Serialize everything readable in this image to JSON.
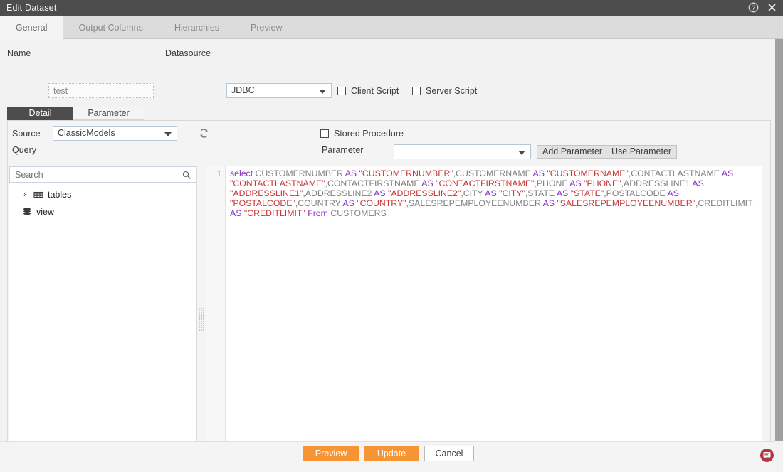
{
  "window": {
    "title": "Edit Dataset",
    "help_icon": "help-icon",
    "close_icon": "close-icon"
  },
  "top_tabs": [
    {
      "label": "General",
      "active": true
    },
    {
      "label": "Output Columns",
      "active": false
    },
    {
      "label": "Hierarchies",
      "active": false
    },
    {
      "label": "Preview",
      "active": false
    }
  ],
  "form": {
    "name_label": "Name",
    "name_value": "test",
    "name_placeholder": "",
    "datasource_label": "Datasource",
    "datasource_value": "JDBC",
    "client_script_label": "Client Script",
    "client_script_checked": false,
    "server_script_label": "Server Script",
    "server_script_checked": false
  },
  "sub_tabs": [
    {
      "label": "Detail",
      "active": true
    },
    {
      "label": "Parameter",
      "active": false
    }
  ],
  "panel": {
    "source_label": "Source",
    "source_value": "ClassicModels",
    "refresh_icon": "refresh-icon",
    "stored_procedure_label": "Stored Procedure",
    "stored_procedure_checked": false,
    "query_label": "Query",
    "parameter_label": "Parameter",
    "parameter_value": "",
    "add_parameter_label": "Add Parameter",
    "use_parameter_label": "Use Parameter"
  },
  "tree": {
    "search_placeholder": "Search",
    "search_value": "",
    "search_icon": "search-icon",
    "items": [
      {
        "label": "tables",
        "icon": "table-grid-icon",
        "expandable": true,
        "chevron": "›"
      },
      {
        "label": "view",
        "icon": "database-stack-icon",
        "expandable": false,
        "chevron": ""
      }
    ]
  },
  "editor": {
    "line_number": "1",
    "tokens": [
      {
        "t": "select",
        "k": "kw"
      },
      {
        "t": " CUSTOMERNUMBER ",
        "k": "plain"
      },
      {
        "t": "AS",
        "k": "kw"
      },
      {
        "t": " ",
        "k": "plain"
      },
      {
        "t": "\"CUSTOMERNUMBER\"",
        "k": "str"
      },
      {
        "t": ",CUSTOMERNAME ",
        "k": "plain"
      },
      {
        "t": "AS",
        "k": "kw"
      },
      {
        "t": " ",
        "k": "plain"
      },
      {
        "t": "\"CUSTOMERNAME\"",
        "k": "str"
      },
      {
        "t": ",CONTACTLASTNAME ",
        "k": "plain"
      },
      {
        "t": "AS",
        "k": "kw"
      },
      {
        "t": " ",
        "k": "plain"
      },
      {
        "t": "\"CONTACTLASTNAME\"",
        "k": "str"
      },
      {
        "t": ",CONTACTFIRSTNAME ",
        "k": "plain"
      },
      {
        "t": "AS",
        "k": "kw"
      },
      {
        "t": " ",
        "k": "plain"
      },
      {
        "t": "\"CONTACTFIRSTNAME\"",
        "k": "str"
      },
      {
        "t": ",PHONE ",
        "k": "plain"
      },
      {
        "t": "AS",
        "k": "kw"
      },
      {
        "t": " ",
        "k": "plain"
      },
      {
        "t": "\"PHONE\"",
        "k": "str"
      },
      {
        "t": ",ADDRESSLINE1 ",
        "k": "plain"
      },
      {
        "t": "AS",
        "k": "kw"
      },
      {
        "t": " ",
        "k": "plain"
      },
      {
        "t": "\"ADDRESSLINE1\"",
        "k": "str"
      },
      {
        "t": ",ADDRESSLINE2 ",
        "k": "plain"
      },
      {
        "t": "AS",
        "k": "kw"
      },
      {
        "t": " ",
        "k": "plain"
      },
      {
        "t": "\"ADDRESSLINE2\"",
        "k": "str"
      },
      {
        "t": ",CITY ",
        "k": "plain"
      },
      {
        "t": "AS",
        "k": "kw"
      },
      {
        "t": " ",
        "k": "plain"
      },
      {
        "t": "\"CITY\"",
        "k": "str"
      },
      {
        "t": ",STATE ",
        "k": "plain"
      },
      {
        "t": "AS",
        "k": "kw"
      },
      {
        "t": " ",
        "k": "plain"
      },
      {
        "t": "\"STATE\"",
        "k": "str"
      },
      {
        "t": ",POSTALCODE ",
        "k": "plain"
      },
      {
        "t": "AS",
        "k": "kw"
      },
      {
        "t": " ",
        "k": "plain"
      },
      {
        "t": "\"POSTALCODE\"",
        "k": "str"
      },
      {
        "t": ",COUNTRY ",
        "k": "plain"
      },
      {
        "t": "AS",
        "k": "kw"
      },
      {
        "t": " ",
        "k": "plain"
      },
      {
        "t": "\"COUNTRY\"",
        "k": "str"
      },
      {
        "t": ",SALESREPEMPLOYEENUMBER ",
        "k": "plain"
      },
      {
        "t": "AS",
        "k": "kw"
      },
      {
        "t": " ",
        "k": "plain"
      },
      {
        "t": "\"SALESREPEMPLOYEENUMBER\"",
        "k": "str"
      },
      {
        "t": ",CREDITLIMIT ",
        "k": "plain"
      },
      {
        "t": "AS",
        "k": "kw"
      },
      {
        "t": " ",
        "k": "plain"
      },
      {
        "t": "\"CREDITLIMIT\"",
        "k": "str"
      },
      {
        "t": " ",
        "k": "plain"
      },
      {
        "t": "From",
        "k": "kw"
      },
      {
        "t": " CUSTOMERS",
        "k": "plain"
      }
    ]
  },
  "footer": {
    "preview_label": "Preview",
    "update_label": "Update",
    "cancel_label": "Cancel",
    "feedback_icon": "feedback-chat-icon"
  },
  "colors": {
    "titlebar": "#4d4d4d",
    "accent_orange": "#f79433",
    "tab_active_bg": "#f4f4f4",
    "keyword": "#8b30c9",
    "string": "#c83737",
    "feedback": "#ad3a40"
  }
}
